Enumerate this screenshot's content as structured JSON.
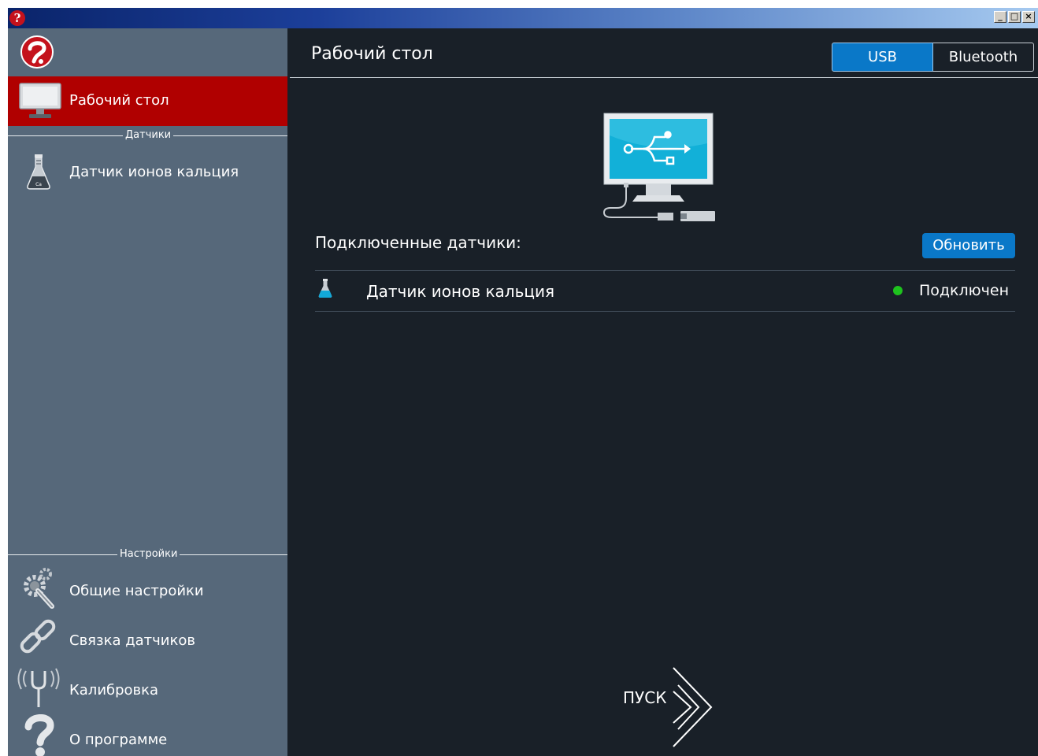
{
  "window": {
    "logo_glyph": "?",
    "controls": [
      "_",
      "□",
      "×"
    ]
  },
  "sidebar": {
    "active_item": {
      "label": "Рабочий стол",
      "icon": "monitor-icon"
    },
    "sensors_section": "Датчики",
    "sensors": [
      {
        "label": "Датчик ионов кальция",
        "icon": "calcium-flask-icon"
      }
    ],
    "settings_section": "Настройки",
    "settings_items": [
      {
        "label": "Общие настройки",
        "icon": "gears-icon"
      },
      {
        "label": "Связка датчиков",
        "icon": "chain-link-icon"
      },
      {
        "label": "Калибровка",
        "icon": "tuning-fork-icon"
      },
      {
        "label": "О программе",
        "icon": "question-icon"
      }
    ]
  },
  "header": {
    "title": "Рабочий стол",
    "tabs": [
      {
        "label": "USB",
        "selected": true
      },
      {
        "label": "Bluetooth",
        "selected": false
      }
    ]
  },
  "main": {
    "illustration_icon": "usb-monitor-icon",
    "connected_label": "Подключенные датчики:",
    "refresh_button": "Обновить",
    "sensors": [
      {
        "name": "Датчик ионов кальция",
        "status": "Подключен",
        "status_color": "#1ec31e",
        "icon": "flask-icon"
      }
    ],
    "start_label": "ПУСК"
  },
  "colors": {
    "accent_blue": "#0a78c8",
    "active_red": "#b00000",
    "sidebar_bg": "#56687a",
    "main_bg": "#192028"
  }
}
